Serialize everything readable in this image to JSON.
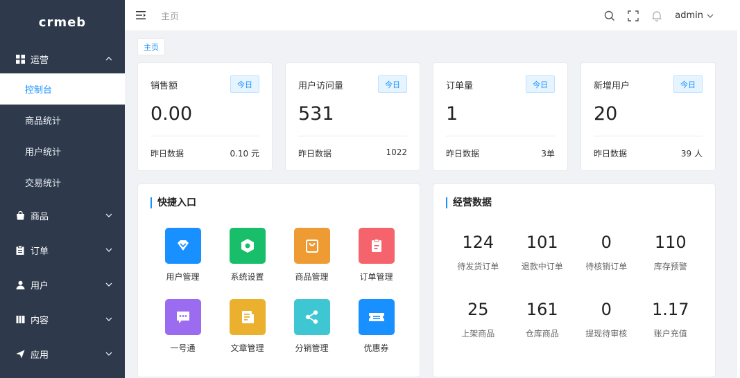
{
  "logo": {
    "text": "crmeb"
  },
  "sidebar": {
    "groups": [
      {
        "label": "运营",
        "icon": "grid-icon",
        "expanded": true,
        "items": [
          {
            "label": "控制台",
            "active": true
          },
          {
            "label": "商品统计"
          },
          {
            "label": "用户统计"
          },
          {
            "label": "交易统计"
          }
        ]
      },
      {
        "label": "商品",
        "icon": "bag-icon"
      },
      {
        "label": "订单",
        "icon": "clipboard-icon"
      },
      {
        "label": "用户",
        "icon": "user-icon"
      },
      {
        "label": "内容",
        "icon": "book-icon"
      },
      {
        "label": "应用",
        "icon": "send-icon"
      }
    ]
  },
  "header": {
    "breadcrumb": "主页",
    "user": "admin"
  },
  "tabs": {
    "active": "主页"
  },
  "stats": [
    {
      "title": "销售额",
      "badge": "今日",
      "value": "0.00",
      "foot_label": "昨日数据",
      "foot_value": "0.10 元"
    },
    {
      "title": "用户访问量",
      "badge": "今日",
      "value": "531",
      "foot_label": "昨日数据",
      "foot_value": "1022"
    },
    {
      "title": "订单量",
      "badge": "今日",
      "value": "1",
      "foot_label": "昨日数据",
      "foot_value": "3单"
    },
    {
      "title": "新增用户",
      "badge": "今日",
      "value": "20",
      "foot_label": "昨日数据",
      "foot_value": "39 人"
    }
  ],
  "quick": {
    "title": "快捷入口",
    "items": [
      {
        "label": "用户管理",
        "color": "#1890ff",
        "icon": "diamond-icon"
      },
      {
        "label": "系统设置",
        "color": "#19be6b",
        "icon": "hexagon-icon"
      },
      {
        "label": "商品管理",
        "color": "#ef9b34",
        "icon": "bag-icon"
      },
      {
        "label": "订单管理",
        "color": "#f5646c",
        "icon": "clipboard-icon"
      },
      {
        "label": "一号通",
        "color": "#9b6cf0",
        "icon": "chat-icon"
      },
      {
        "label": "文章管理",
        "color": "#eab02e",
        "icon": "document-icon"
      },
      {
        "label": "分销管理",
        "color": "#3fc6d3",
        "icon": "share-icon"
      },
      {
        "label": "优惠券",
        "color": "#1890ff",
        "icon": "ticket-icon"
      }
    ]
  },
  "business": {
    "title": "经营数据",
    "items": [
      {
        "value": "124",
        "label": "待发货订单"
      },
      {
        "value": "101",
        "label": "退款中订单"
      },
      {
        "value": "0",
        "label": "待核销订单"
      },
      {
        "value": "110",
        "label": "库存预警"
      },
      {
        "value": "25",
        "label": "上架商品"
      },
      {
        "value": "161",
        "label": "仓库商品"
      },
      {
        "value": "0",
        "label": "提现待审核"
      },
      {
        "value": "1.17",
        "label": "账户充值"
      }
    ]
  }
}
